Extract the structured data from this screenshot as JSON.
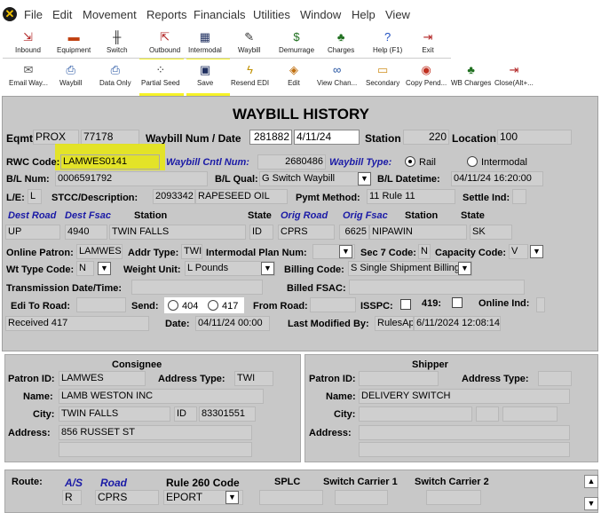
{
  "menu": [
    "File",
    "Edit",
    "Movement",
    "Reports",
    "Financials",
    "Utilities",
    "Window",
    "Help",
    "View"
  ],
  "toolbar1": [
    {
      "label": "Inbound",
      "icon": "inbound-icon",
      "glyph": "⇲",
      "color": "#b02020"
    },
    {
      "label": "Equipment",
      "icon": "equipment-icon",
      "glyph": "▬",
      "color": "#c04010"
    },
    {
      "label": "Switch",
      "icon": "switch-icon",
      "glyph": "╫",
      "color": "#222"
    },
    {
      "label": "Outbound",
      "icon": "outbound-icon",
      "glyph": "⇱",
      "color": "#b02020"
    },
    {
      "label": "Intermodal",
      "icon": "intermodal-icon",
      "glyph": "▦",
      "color": "#203060"
    },
    {
      "label": "Waybill",
      "icon": "waybill-icon",
      "glyph": "✎",
      "color": "#333"
    },
    {
      "label": "Demurrage",
      "icon": "demurrage-icon",
      "glyph": "$",
      "color": "#207020"
    },
    {
      "label": "Charges",
      "icon": "charges-icon",
      "glyph": "♣",
      "color": "#207020"
    },
    {
      "label": "Help (F1)",
      "icon": "help-icon",
      "glyph": "?",
      "color": "#2050c0"
    },
    {
      "label": "Exit",
      "icon": "exit-icon",
      "glyph": "⇥",
      "color": "#b02020"
    }
  ],
  "toolbar2": [
    {
      "label": "Email Way...",
      "icon": "email-icon",
      "glyph": "✉",
      "color": "#555"
    },
    {
      "label": "Waybill",
      "icon": "print-waybill-icon",
      "glyph": "⎙",
      "color": "#2050a0"
    },
    {
      "label": "Data Only",
      "icon": "data-only-icon",
      "glyph": "⎙",
      "color": "#2050a0"
    },
    {
      "label": "Partial Seed",
      "icon": "partial-seed-icon",
      "glyph": "⁘",
      "color": "#333"
    },
    {
      "label": "Save",
      "icon": "save-icon",
      "glyph": "▣",
      "color": "#203060"
    },
    {
      "label": "Resend EDI",
      "icon": "resend-edi-icon",
      "glyph": "ϟ",
      "color": "#c09000"
    },
    {
      "label": "Edit",
      "icon": "edit-icon",
      "glyph": "◈",
      "color": "#c07010"
    },
    {
      "label": "View Chan...",
      "icon": "view-changes-icon",
      "glyph": "∞",
      "color": "#2050a0"
    },
    {
      "label": "Secondary",
      "icon": "secondary-icon",
      "glyph": "▭",
      "color": "#d09020"
    },
    {
      "label": "Copy Pend...",
      "icon": "copy-pending-icon",
      "glyph": "◉",
      "color": "#c03020"
    },
    {
      "label": "WB Charges",
      "icon": "wb-charges-icon",
      "glyph": "♣",
      "color": "#207020"
    },
    {
      "label": "Close(Alt+...",
      "icon": "close-icon",
      "glyph": "⇥",
      "color": "#b02020"
    }
  ],
  "form": {
    "title": "WAYBILL HISTORY",
    "eqmt_label": "Eqmt",
    "eqmt_initial": "PROX",
    "eqmt_number": "77178",
    "waybill_num_date_label": "Waybill Num / Date",
    "waybill_num": "281882",
    "waybill_date": "4/11/24",
    "station_label": "Station",
    "station_value": "220",
    "location_label": "Location",
    "location_value": "100",
    "rwc_code_label": "RWC Code:",
    "rwc_code": "LAMWES0141",
    "waybill_cntl_label": "Waybill Cntl Num:",
    "waybill_cntl": "2680486",
    "waybill_type_label": "Waybill Type:",
    "rail_label": "Rail",
    "intermodal_label": "Intermodal",
    "bl_num_label": "B/L Num:",
    "bl_num": "0006591792",
    "bl_qual_label": "B/L Qual:",
    "bl_qual": "G Switch Waybill",
    "bl_datetime_label": "B/L Datetime:",
    "bl_datetime": "04/11/24 16:20:00",
    "le_label": "L/E:",
    "le_value": "L",
    "stcc_label": "STCC/Description:",
    "stcc": "2093342",
    "stcc_desc": "RAPESEED OIL",
    "pymt_label": "Pymt Method:",
    "pymt_value": "11 Rule 11",
    "settle_label": "Settle Ind:",
    "dest_road_label": "Dest Road",
    "dest_fsac_label": "Dest Fsac",
    "station_col_label": "Station",
    "state_col_label": "State",
    "orig_road_label": "Orig Road",
    "orig_fsac_label": "Orig Fsac",
    "station_col2_label": "Station",
    "state_col2_label": "State",
    "dest_road": "UP",
    "dest_fsac": "4940",
    "dest_station": "TWIN FALLS",
    "dest_state": "ID",
    "orig_road": "CPRS",
    "orig_fsac": "6625",
    "orig_station": "NIPAWIN",
    "orig_state": "SK",
    "online_patron_label": "Online Patron:",
    "online_patron": "LAMWES",
    "addr_type_label": "Addr Type:",
    "addr_type": "TWI",
    "intermodal_plan_label": "Intermodal Plan Num:",
    "sec7_label": "Sec 7 Code:",
    "sec7_value": "N",
    "capacity_label": "Capacity Code:",
    "capacity_value": "V",
    "wt_type_label": "Wt Type Code:",
    "wt_type": "N",
    "weight_unit_label": "Weight Unit:",
    "weight_unit": "L Pounds",
    "billing_code_label": "Billing Code:",
    "billing_code": "S Single Shipment Billing",
    "trans_dt_label": "Transmission Date/Time:",
    "billed_fsac_label": "Billed FSAC:",
    "edi_to_road_label": "Edi To Road:",
    "send_label": "Send:",
    "send_404": "404",
    "send_417": "417",
    "from_road_label": "From Road:",
    "isspc_label": "ISSPC:",
    "n419_label": "419:",
    "online_ind_label": "Online Ind:",
    "received": "Received 417",
    "date_label": "Date:",
    "date_value": "04/11/24 00:00",
    "last_modified_label": "Last Modified By:",
    "last_modified_user": "RulesAp",
    "last_modified_dt": "6/11/2024 12:08:14"
  },
  "consignee": {
    "title": "Consignee",
    "patron_label": "Patron ID:",
    "patron": "LAMWES",
    "addr_type_label": "Address Type:",
    "addr_type": "TWI",
    "name_label": "Name:",
    "name": "LAMB WESTON INC",
    "city_label": "City:",
    "city": "TWIN FALLS",
    "state": "ID",
    "zip": "83301551",
    "address_label": "Address:",
    "address": "856 RUSSET ST"
  },
  "shipper": {
    "title": "Shipper",
    "patron_label": "Patron ID:",
    "addr_type_label": "Address Type:",
    "name_label": "Name:",
    "name": "DELIVERY SWITCH",
    "city_label": "City:",
    "address_label": "Address:"
  },
  "route": {
    "route_label": "Route:",
    "as_label": "A/S",
    "road_label": "Road",
    "rule260_label": "Rule 260 Code",
    "splc_label": "SPLC",
    "switch1_label": "Switch Carrier 1",
    "switch2_label": "Switch Carrier 2",
    "as_value": "R",
    "road_value": "CPRS",
    "rule260_value": "EPORT"
  }
}
